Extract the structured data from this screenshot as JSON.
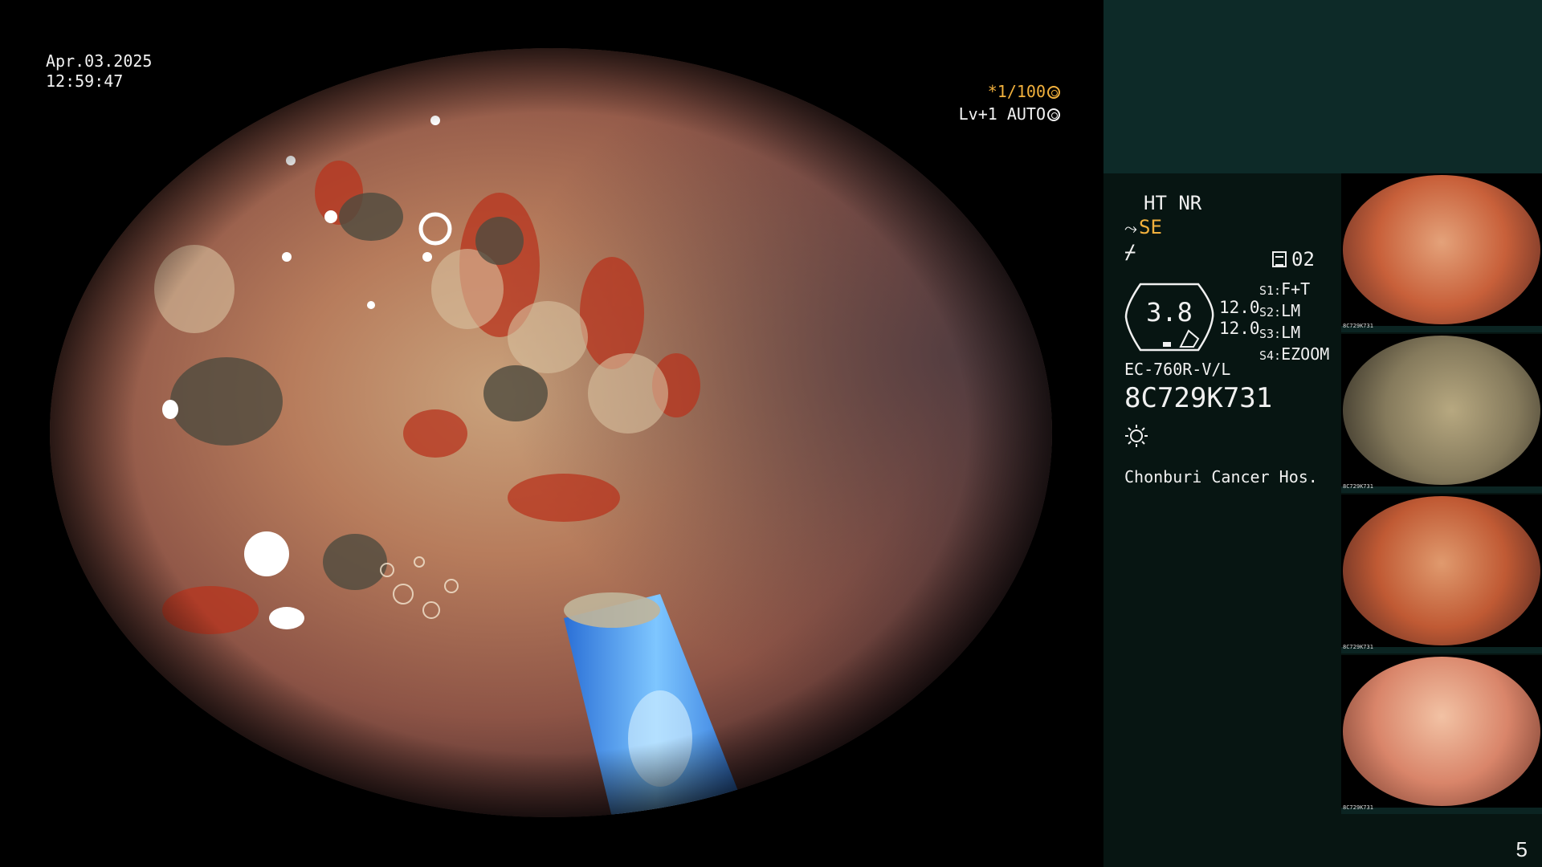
{
  "overlay": {
    "date": "Apr.03.2025",
    "time": "12:59:47",
    "shutter": "*1/100",
    "agc": "Lv+1 AUTO"
  },
  "panel": {
    "mode": "HT NR",
    "enhance": "SE",
    "memory": "02",
    "gauge_value": "3.8",
    "gauge_num_1": "12.0",
    "gauge_num_2": "12.0",
    "switches": [
      {
        "key": "S1:",
        "value": "F+T"
      },
      {
        "key": "S2:",
        "value": "LM"
      },
      {
        "key": "S3:",
        "value": "LM"
      },
      {
        "key": "S4:",
        "value": "EZOOM"
      }
    ],
    "scope_model": "EC-760R-V/L",
    "scope_serial": "8C729K731",
    "hospital": "Chonburi Cancer Hos."
  },
  "thumbnails": [
    {
      "serial": "8C729K731",
      "tone": "#c8603a"
    },
    {
      "serial": "8C729K731",
      "tone": "#857a5c"
    },
    {
      "serial": "8C729K731",
      "tone": "#c05a34"
    },
    {
      "serial": "8C729K731",
      "tone": "#d9856a"
    }
  ],
  "page_number": "5",
  "colors": {
    "accent_yellow": "#f2b13d",
    "panel_bg": "#071512",
    "panel_top": "#0d2a28",
    "instrument_blue": "#3a8fe0"
  }
}
